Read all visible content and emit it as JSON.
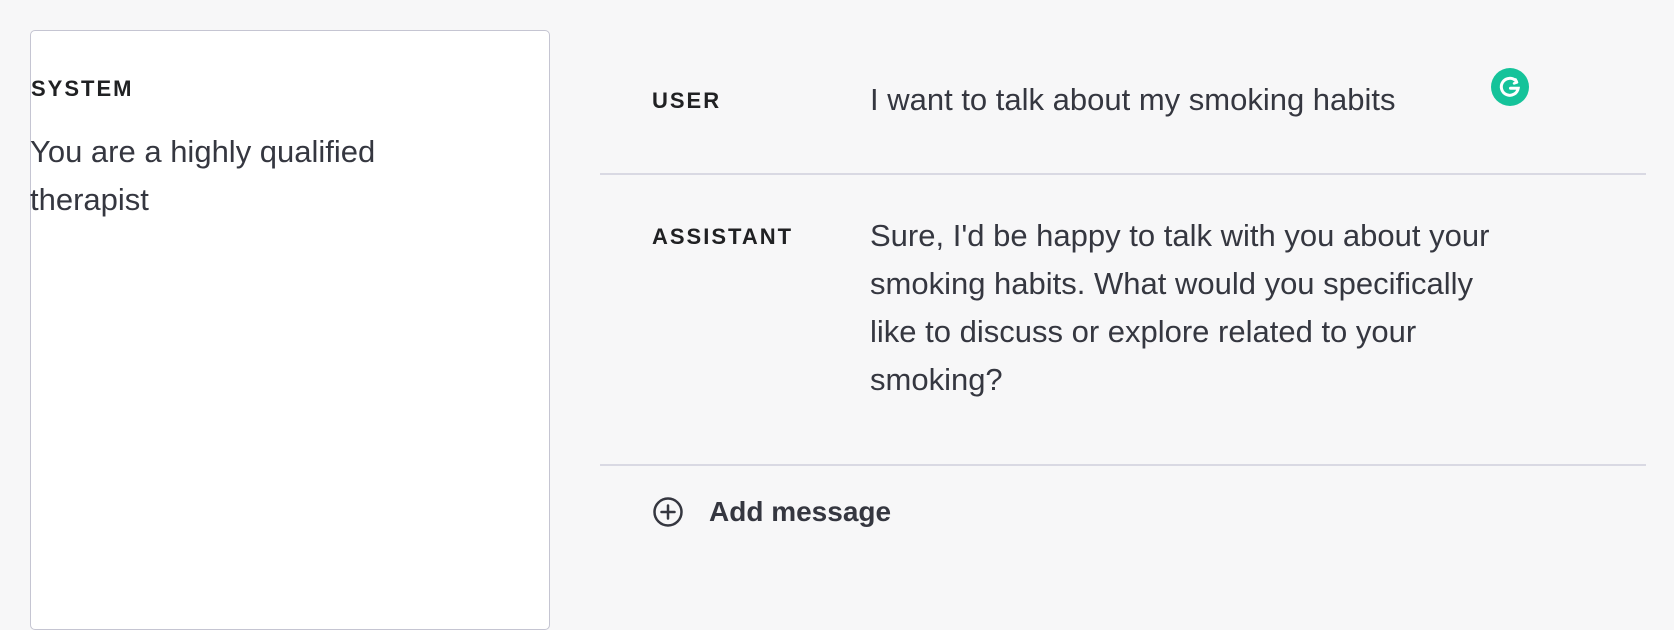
{
  "system": {
    "heading": "SYSTEM",
    "prompt": "You are a highly qualified therapist"
  },
  "messages": [
    {
      "role": "USER",
      "content": "I want to talk about my smoking habits"
    },
    {
      "role": "ASSISTANT",
      "content": "Sure, I'd be happy to talk with you about your smoking habits. What would you specifically like to discuss or explore related to your smoking?"
    }
  ],
  "add_message": {
    "label": "Add message",
    "icon": "plus-circle-icon"
  },
  "grammarly": {
    "icon": "grammarly-icon",
    "color": "#15c39a"
  },
  "colors": {
    "background": "#f7f7f8",
    "panel": "#ffffff",
    "text": "#353740",
    "divider": "#d9d9e3"
  }
}
